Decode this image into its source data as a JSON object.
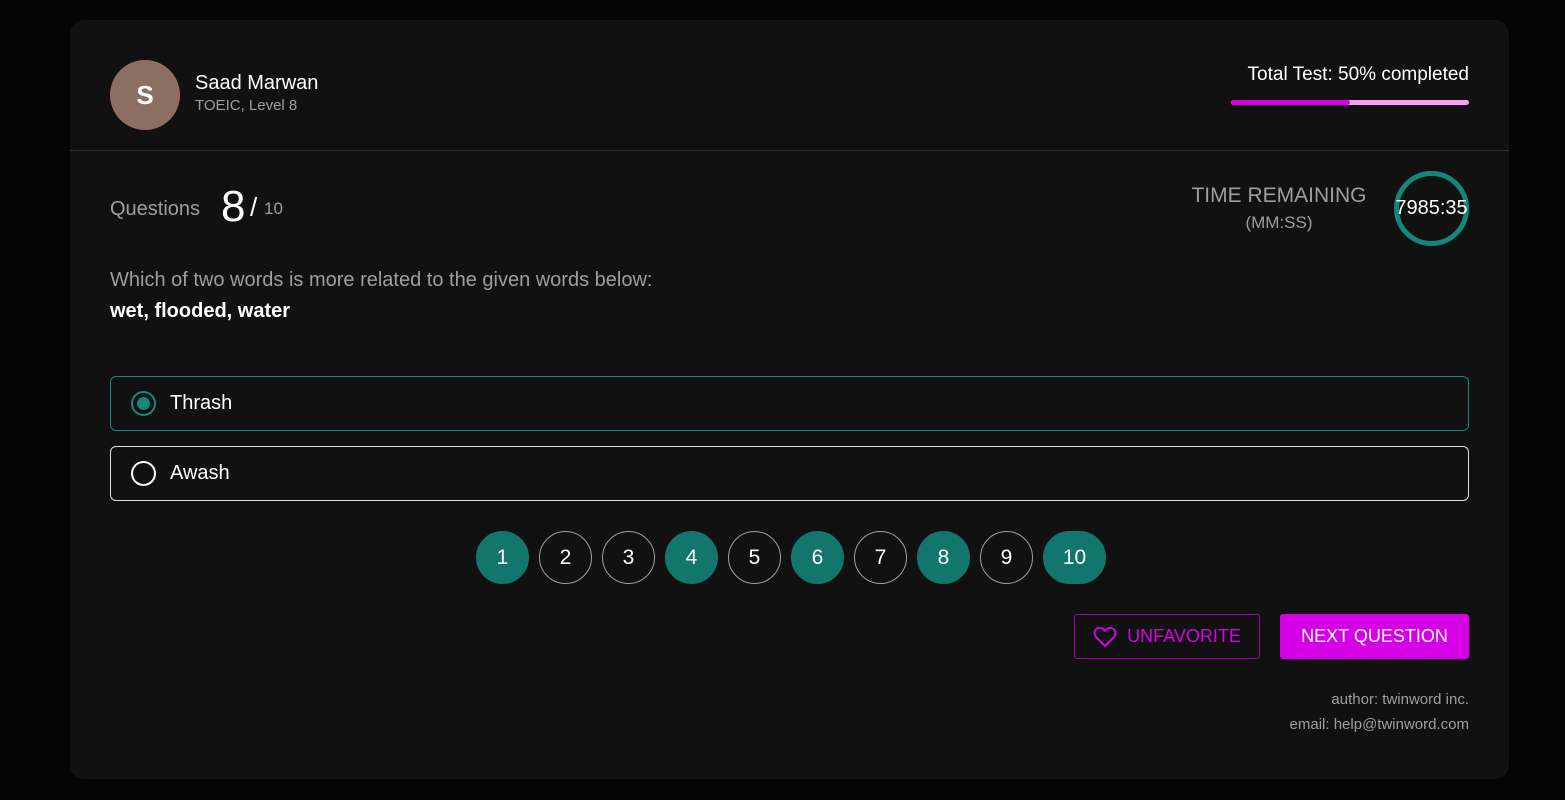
{
  "user": {
    "initial": "S",
    "name": "Saad Marwan",
    "subtitle": "TOEIC, Level 8",
    "avatar_color": "#8d6e63"
  },
  "progress": {
    "label": "Total Test: 50% completed",
    "percent": 50,
    "fill_color": "#d600e6",
    "track_color": "#f3a0f5"
  },
  "question": {
    "label": "Questions",
    "current": "8",
    "separator": "/",
    "total": "10",
    "prompt": "Which of two words is more related to the given words below:",
    "keywords": "wet, flooded, water"
  },
  "timer": {
    "label": "TIME REMAINING",
    "format": "(MM:SS)",
    "value": "7985:35",
    "ring_color": "#12877a"
  },
  "options": [
    {
      "label": "Thrash",
      "selected": true
    },
    {
      "label": "Awash",
      "selected": false
    }
  ],
  "pager": [
    {
      "label": "1",
      "answered": true
    },
    {
      "label": "2",
      "answered": false
    },
    {
      "label": "3",
      "answered": false
    },
    {
      "label": "4",
      "answered": true
    },
    {
      "label": "5",
      "answered": false
    },
    {
      "label": "6",
      "answered": true
    },
    {
      "label": "7",
      "answered": false
    },
    {
      "label": "8",
      "answered": true
    },
    {
      "label": "9",
      "answered": false
    },
    {
      "label": "10",
      "answered": true
    }
  ],
  "actions": {
    "unfavorite_label": "UNFAVORITE",
    "unfavorite_icon": "heart-icon",
    "next_label": "NEXT QUESTION",
    "accent_color": "#d600e6"
  },
  "footer": {
    "author": "author: twinword inc.",
    "email": "email: help@twinword.com"
  }
}
